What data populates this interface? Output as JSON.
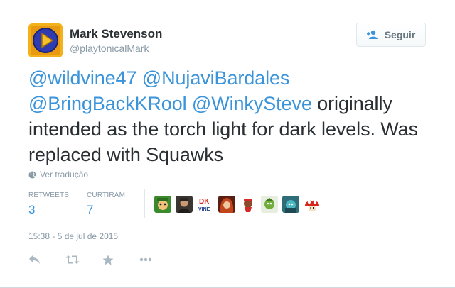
{
  "author": {
    "name": "Mark Stevenson",
    "handle": "@playtonicalMark"
  },
  "follow_button": {
    "label": "Seguir",
    "icon": "follow-person-plus-icon"
  },
  "tweet": {
    "mentions": [
      "@wildvine47",
      "@NujaviBardales",
      "@BringBackKRool",
      "@WinkySteve"
    ],
    "text": "originally intended as the torch light for dark levels. Was replaced with Squawks"
  },
  "translate_link": {
    "label": "Ver tradução",
    "icon": "globe-icon"
  },
  "stats": {
    "retweets": {
      "label": "RETWEETS",
      "value": "3"
    },
    "likes": {
      "label": "CURTIRAM",
      "value": "7"
    }
  },
  "likers": [
    "liker-1",
    "liker-2",
    "liker-3",
    "liker-4",
    "liker-5",
    "liker-6",
    "liker-7",
    "liker-8"
  ],
  "timestamp": "15:38 - 5 de jul de 2015",
  "actions": [
    "reply-icon",
    "retweet-icon",
    "favorite-star-icon",
    "more-dots-icon"
  ],
  "colors": {
    "link": "#3b94d9",
    "text": "#292f33",
    "muted": "#8899a6",
    "divider": "#e1e8ed"
  }
}
